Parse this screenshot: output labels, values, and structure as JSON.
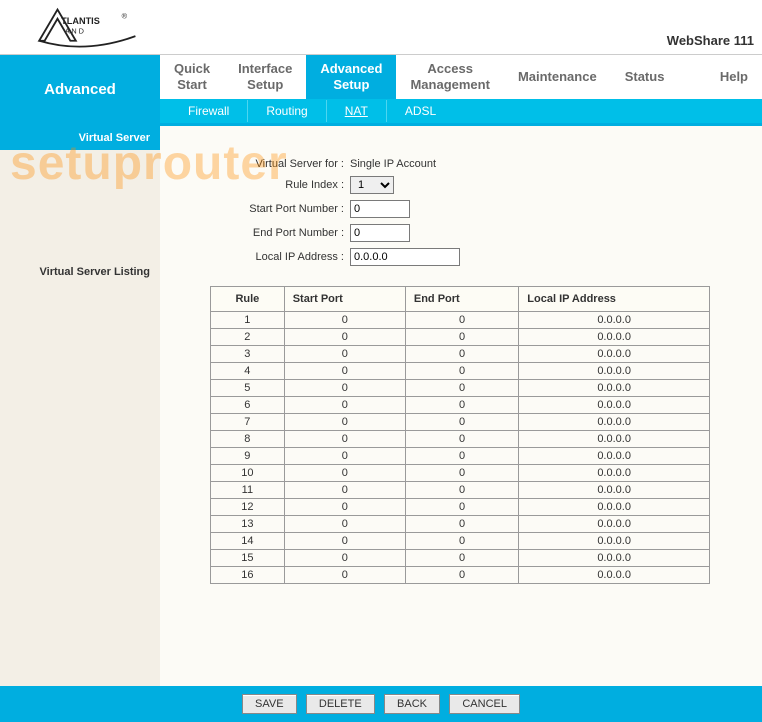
{
  "brand": {
    "logo_text": "ATLANTIS LAND®",
    "product": "WebShare 111"
  },
  "nav": {
    "current": "Advanced",
    "main": [
      {
        "label": "Quick\nStart"
      },
      {
        "label": "Interface\nSetup"
      },
      {
        "label": "Advanced\nSetup",
        "active": true
      },
      {
        "label": "Access\nManagement"
      },
      {
        "label": "Maintenance"
      },
      {
        "label": "Status"
      },
      {
        "label": "Help"
      }
    ],
    "sub": [
      {
        "label": "Firewall"
      },
      {
        "label": "Routing"
      },
      {
        "label": "NAT",
        "active": true
      },
      {
        "label": "ADSL"
      }
    ]
  },
  "side": {
    "section1": "Virtual Server",
    "section2": "Virtual Server Listing"
  },
  "form": {
    "vs_for_label": "Virtual Server for :",
    "vs_for_value": "Single IP Account",
    "rule_index_label": "Rule Index :",
    "rule_index_value": "1",
    "start_port_label": "Start Port Number :",
    "start_port_value": "0",
    "end_port_label": "End Port Number :",
    "end_port_value": "0",
    "local_ip_label": "Local IP Address :",
    "local_ip_value": "0.0.0.0"
  },
  "table": {
    "headers": {
      "rule": "Rule",
      "start": "Start Port",
      "end": "End Port",
      "ip": "Local IP Address"
    },
    "rows": [
      {
        "rule": "1",
        "start": "0",
        "end": "0",
        "ip": "0.0.0.0"
      },
      {
        "rule": "2",
        "start": "0",
        "end": "0",
        "ip": "0.0.0.0"
      },
      {
        "rule": "3",
        "start": "0",
        "end": "0",
        "ip": "0.0.0.0"
      },
      {
        "rule": "4",
        "start": "0",
        "end": "0",
        "ip": "0.0.0.0"
      },
      {
        "rule": "5",
        "start": "0",
        "end": "0",
        "ip": "0.0.0.0"
      },
      {
        "rule": "6",
        "start": "0",
        "end": "0",
        "ip": "0.0.0.0"
      },
      {
        "rule": "7",
        "start": "0",
        "end": "0",
        "ip": "0.0.0.0"
      },
      {
        "rule": "8",
        "start": "0",
        "end": "0",
        "ip": "0.0.0.0"
      },
      {
        "rule": "9",
        "start": "0",
        "end": "0",
        "ip": "0.0.0.0"
      },
      {
        "rule": "10",
        "start": "0",
        "end": "0",
        "ip": "0.0.0.0"
      },
      {
        "rule": "11",
        "start": "0",
        "end": "0",
        "ip": "0.0.0.0"
      },
      {
        "rule": "12",
        "start": "0",
        "end": "0",
        "ip": "0.0.0.0"
      },
      {
        "rule": "13",
        "start": "0",
        "end": "0",
        "ip": "0.0.0.0"
      },
      {
        "rule": "14",
        "start": "0",
        "end": "0",
        "ip": "0.0.0.0"
      },
      {
        "rule": "15",
        "start": "0",
        "end": "0",
        "ip": "0.0.0.0"
      },
      {
        "rule": "16",
        "start": "0",
        "end": "0",
        "ip": "0.0.0.0"
      }
    ]
  },
  "buttons": {
    "save": "SAVE",
    "delete": "DELETE",
    "back": "BACK",
    "cancel": "CANCEL"
  },
  "watermark": "setuprouter"
}
